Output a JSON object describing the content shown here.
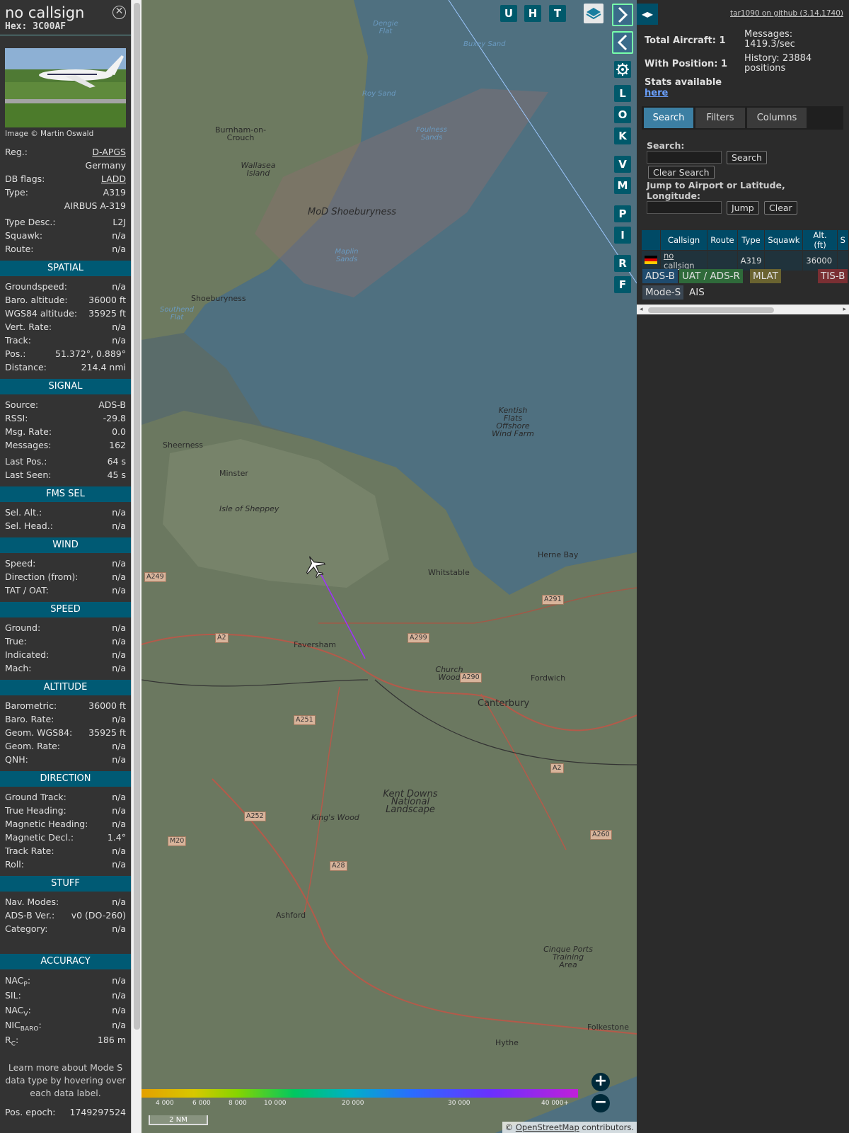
{
  "info": {
    "callsign": "no callsign",
    "hex_label": "Hex:",
    "hex": "3C00AF",
    "image_credit": "Image © Martin Oswald",
    "basic": [
      {
        "k": "Reg.:",
        "v": "D-APGS",
        "link": true
      },
      {
        "k": "",
        "v": "Germany"
      },
      {
        "k": "DB flags:",
        "v": "LADD",
        "link": true
      },
      {
        "k": "Type:",
        "v": "A319"
      },
      {
        "k": "",
        "v": "AIRBUS A-319"
      },
      {
        "k": "Type Desc.:",
        "v": "L2J",
        "gap": true
      },
      {
        "k": "Squawk:",
        "v": "n/a"
      },
      {
        "k": "Route:",
        "v": "n/a"
      }
    ],
    "sections": [
      {
        "title": "SPATIAL",
        "rows": [
          {
            "k": "Groundspeed:",
            "v": "n/a"
          },
          {
            "k": "Baro. altitude:",
            "v": "36000 ft"
          },
          {
            "k": "WGS84 altitude:",
            "v": "35925 ft"
          },
          {
            "k": "Vert. Rate:",
            "v": "n/a"
          },
          {
            "k": "Track:",
            "v": "n/a"
          },
          {
            "k": "Pos.:",
            "v": "51.372°, 0.889°"
          },
          {
            "k": "Distance:",
            "v": "214.4 nmi"
          }
        ]
      },
      {
        "title": "SIGNAL",
        "rows": [
          {
            "k": "Source:",
            "v": "ADS-B"
          },
          {
            "k": "RSSI:",
            "v": "-29.8"
          },
          {
            "k": "Msg. Rate:",
            "v": "0.0"
          },
          {
            "k": "Messages:",
            "v": "162"
          },
          {
            "k": "Last Pos.:",
            "v": "64 s",
            "gap": true
          },
          {
            "k": "Last Seen:",
            "v": "45 s"
          }
        ]
      },
      {
        "title": "FMS SEL",
        "rows": [
          {
            "k": "Sel. Alt.:",
            "v": "n/a"
          },
          {
            "k": "Sel. Head.:",
            "v": "n/a"
          }
        ]
      },
      {
        "title": "WIND",
        "rows": [
          {
            "k": "Speed:",
            "v": "n/a"
          },
          {
            "k": "Direction (from):",
            "v": "n/a"
          },
          {
            "k": "TAT / OAT:",
            "v": "n/a"
          }
        ]
      },
      {
        "title": "SPEED",
        "rows": [
          {
            "k": "Ground:",
            "v": "n/a"
          },
          {
            "k": "True:",
            "v": "n/a"
          },
          {
            "k": "Indicated:",
            "v": "n/a"
          },
          {
            "k": "Mach:",
            "v": "n/a"
          }
        ]
      },
      {
        "title": "ALTITUDE",
        "rows": [
          {
            "k": "Barometric:",
            "v": "36000 ft"
          },
          {
            "k": "Baro. Rate:",
            "v": "n/a"
          },
          {
            "k": "Geom. WGS84:",
            "v": "35925 ft"
          },
          {
            "k": "Geom. Rate:",
            "v": "n/a"
          },
          {
            "k": "QNH:",
            "v": "n/a"
          }
        ]
      },
      {
        "title": "DIRECTION",
        "rows": [
          {
            "k": "Ground Track:",
            "v": "n/a"
          },
          {
            "k": "True Heading:",
            "v": "n/a"
          },
          {
            "k": "Magnetic Heading:",
            "v": "n/a"
          },
          {
            "k": "Magnetic Decl.:",
            "v": "1.4°"
          },
          {
            "k": "Track Rate:",
            "v": "n/a"
          },
          {
            "k": "Roll:",
            "v": "n/a"
          }
        ]
      },
      {
        "title": "STUFF",
        "rows": [
          {
            "k": "Nav. Modes:",
            "v": "n/a"
          },
          {
            "k": "ADS-B Ver.:",
            "v": "v0 (DO-260)"
          },
          {
            "k": "Category:",
            "v": "n/a"
          }
        ]
      }
    ],
    "accuracy_title": "ACCURACY",
    "accuracy": [
      {
        "k": "NAC",
        "sub": "P",
        "v": "n/a"
      },
      {
        "k": "SIL:",
        "sub": "",
        "v": "n/a"
      },
      {
        "k": "NAC",
        "sub": "V",
        "v": "n/a"
      },
      {
        "k": "NIC",
        "sub": "BARO",
        "v": "n/a"
      },
      {
        "k": "R",
        "sub": "C",
        "v": "186 m"
      }
    ],
    "learn_more": "Learn more about Mode S data type by hovering over each data label.",
    "pos_epoch_label": "Pos. epoch:",
    "pos_epoch": "1749297524"
  },
  "map": {
    "buttons_top": [
      "U",
      "H",
      "T"
    ],
    "buttons_side": [
      "L",
      "O",
      "K",
      "V",
      "M",
      "P",
      "I",
      "R",
      "F"
    ],
    "labels": [
      {
        "t": "Dengie Flat",
        "c": "sea"
      },
      {
        "t": "Buxey Sand",
        "c": "sea"
      },
      {
        "t": "Roy Sand",
        "c": "sea"
      },
      {
        "t": "Foulness Sands",
        "c": "sea"
      },
      {
        "t": "Burnham-on-Crouch",
        "c": ""
      },
      {
        "t": "Wallasea Island",
        "c": "it"
      },
      {
        "t": "MoD Shoeburyness",
        "c": "it big"
      },
      {
        "t": "Maplin Sands",
        "c": "sea"
      },
      {
        "t": "Shoeburyness",
        "c": ""
      },
      {
        "t": "Southend Flat",
        "c": "sea"
      },
      {
        "t": "Kentish Flats Offshore Wind Farm",
        "c": "it"
      },
      {
        "t": "Sheerness",
        "c": ""
      },
      {
        "t": "Minster",
        "c": ""
      },
      {
        "t": "Isle of Sheppey",
        "c": "it"
      },
      {
        "t": "Whitstable",
        "c": ""
      },
      {
        "t": "Herne Bay",
        "c": ""
      },
      {
        "t": "Faversham",
        "c": ""
      },
      {
        "t": "Church Wood",
        "c": "it"
      },
      {
        "t": "Fordwich",
        "c": ""
      },
      {
        "t": "Canterbury",
        "c": "big"
      },
      {
        "t": "King's Wood",
        "c": "it"
      },
      {
        "t": "Kent Downs National Landscape",
        "c": "it big"
      },
      {
        "t": "Ashford",
        "c": ""
      },
      {
        "t": "Cinque Ports Training Area",
        "c": "it"
      },
      {
        "t": "Hythe",
        "c": ""
      },
      {
        "t": "Folkestone",
        "c": ""
      }
    ],
    "roads": [
      "A249",
      "A2",
      "A299",
      "A291",
      "A290",
      "A251",
      "A2",
      "A252",
      "M20",
      "A28",
      "A260"
    ],
    "scale_ticks": [
      "4 000",
      "6 000",
      "8 000",
      "10 000",
      "20 000",
      "30 000",
      "40 000+"
    ],
    "scale_nm": "2 NM",
    "attribution_prefix": "© ",
    "attribution_link": "OpenStreetMap",
    "attribution_suffix": " contributors.",
    "aircraft_position": {
      "lat": 51.372,
      "lon": 0.889
    }
  },
  "panel": {
    "github": "tar1090 on github (3.14.1740)",
    "total_aircraft": "Total Aircraft: 1",
    "with_position": "With Position: 1",
    "stats_available": "Stats available",
    "here": "here",
    "messages": "Messages: 1419.3/sec",
    "history": "History: 23884 positions",
    "tabs": [
      "Search",
      "Filters",
      "Columns"
    ],
    "search_label": "Search:",
    "search_btn": "Search",
    "clear_search_btn": "Clear Search",
    "jump_label": "Jump to Airport or Latitude, Longitude:",
    "jump_btn": "Jump",
    "clear_btn": "Clear",
    "table_headers": [
      "",
      "Callsign",
      "Route",
      "Type",
      "Squawk",
      "Alt. (ft)",
      "S"
    ],
    "table_rows": [
      {
        "callsign": "no callsign",
        "route": "",
        "type": "A319",
        "squawk": "",
        "alt": "36000"
      }
    ],
    "legend": [
      {
        "t": "ADS-B",
        "bg": "#1f4b6e"
      },
      {
        "t": "UAT / ADS-R",
        "bg": "#2f6a3a"
      },
      {
        "t": "MLAT",
        "bg": "#6a6330"
      },
      {
        "t": "TIS-B",
        "bg": "#7a2f33"
      },
      {
        "t": "Mode-S",
        "bg": "#3a4652"
      },
      {
        "t": "AIS",
        "bg": "transparent"
      }
    ]
  },
  "colors": {
    "accent": "#005a74",
    "button": "#00596b",
    "track": "#a030ff"
  }
}
